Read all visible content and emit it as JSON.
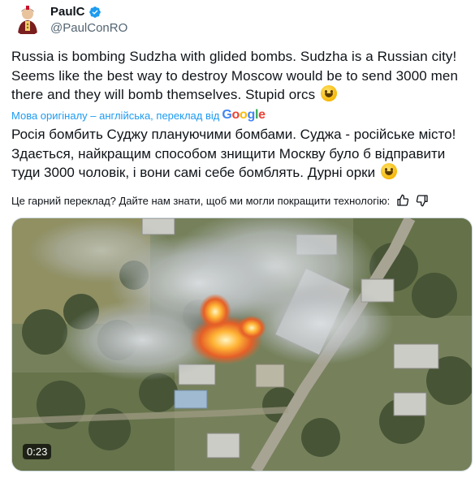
{
  "author": {
    "display_name": "PaulC",
    "handle": "@PaulConRO",
    "verified_icon": "verified-badge-icon"
  },
  "tweet": {
    "text_en": "Russia is bombing Sudzha with glided bombs. Sudzha is a Russian city! Seems like the best way to destroy Moscow would be to send 3000 men there and they will bomb themselves. Stupid orcs",
    "translation_label": "Мова оригіналу – англійська, переклад від",
    "translation_provider": "Google",
    "text_uk": "Росія бомбить Суджу плануючими бомбами. Суджа - російське місто! Здається, найкращим способом знищити Москву було б відправити туди 3000 чоловік, і вони самі себе бомблять. Дурні орки",
    "feedback_prompt": "Це гарний переклад? Дайте нам знати, щоб ми могли покращити технологію:"
  },
  "media": {
    "type": "video",
    "duration": "0:23"
  },
  "colors": {
    "link": "#1d9bf0",
    "text": "#0f1419",
    "muted": "#536471"
  }
}
